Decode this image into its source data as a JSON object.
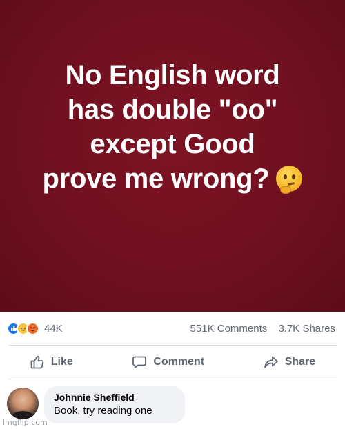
{
  "post": {
    "lines": [
      "No English word",
      "has double \"oo\"",
      "except Good",
      "prove me wrong?"
    ],
    "emoji": "thinking-face-icon",
    "background_color": "#6f1020"
  },
  "stats": {
    "reaction_count": "44K",
    "comments": "551K Comments",
    "shares": "3.7K Shares",
    "reaction_icons": [
      "like-icon",
      "haha-icon",
      "angry-icon"
    ]
  },
  "actions": {
    "like": "Like",
    "comment": "Comment",
    "share": "Share"
  },
  "comment": {
    "author": "Johnnie Sheffield",
    "text": "Book, try reading one"
  },
  "watermark": "imgflip.com"
}
